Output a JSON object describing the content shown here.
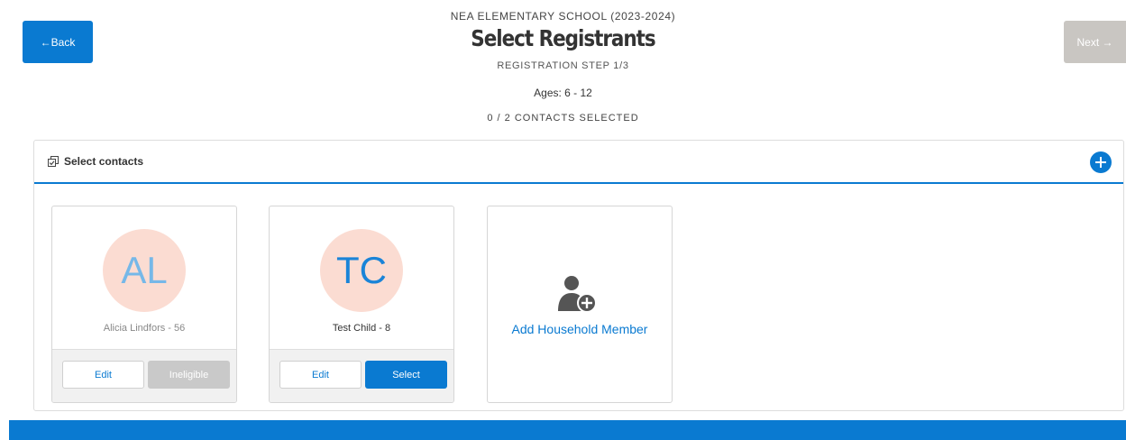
{
  "nav": {
    "back_label": "←Back",
    "next_label": "Next →"
  },
  "header": {
    "school": "NEA ELEMENTARY SCHOOL (2023-2024)",
    "title": "Select Registrants",
    "step": "REGISTRATION STEP 1/3",
    "ages": "Ages: 6 - 12",
    "selected_count": "0 / 2 CONTACTS SELECTED"
  },
  "panel": {
    "title": "Select contacts",
    "icon": "select-contacts-icon",
    "add_icon": "plus-icon"
  },
  "contacts": [
    {
      "initials": "AL",
      "name": "Alicia Lindfors - 56",
      "edit_label": "Edit",
      "action_label": "Ineligible",
      "eligible": false
    },
    {
      "initials": "TC",
      "name": "Test Child - 8",
      "edit_label": "Edit",
      "action_label": "Select",
      "eligible": true
    }
  ],
  "add_member": {
    "label": "Add Household Member",
    "icon": "add-user-icon"
  },
  "colors": {
    "primary": "#0a7ad1",
    "disabled": "#c9c6c2",
    "avatar_bg": "#fbdcd2"
  }
}
